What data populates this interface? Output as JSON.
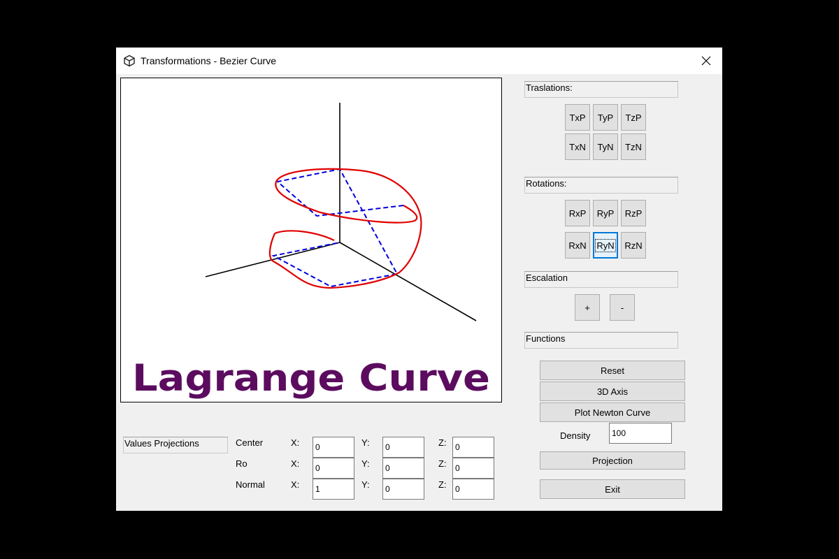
{
  "window": {
    "title": "Transformations - Bezier Curve"
  },
  "canvas": {
    "banner": "Lagrange Curve"
  },
  "translations": {
    "label": "Traslations:",
    "buttons": [
      "TxP",
      "TyP",
      "TzP",
      "TxN",
      "TyN",
      "TzN"
    ]
  },
  "rotations": {
    "label": "Rotations:",
    "buttons": [
      "RxP",
      "RyP",
      "RzP",
      "RxN",
      "RyN",
      "RzN"
    ],
    "focused": "RyN"
  },
  "escalation": {
    "label": "Escalation",
    "plus": "+",
    "minus": "-"
  },
  "functions": {
    "label": "Functions",
    "reset": "Reset",
    "axis": "3D Axis",
    "plot": "Plot Newton Curve",
    "projection": "Projection",
    "exit": "Exit"
  },
  "density": {
    "label": "Density",
    "value": "100"
  },
  "projections": {
    "label": "Values Projections",
    "axis_labels": {
      "x": "X:",
      "y": "Y:",
      "z": "Z:"
    },
    "center": {
      "label": "Center",
      "x": "0",
      "y": "0",
      "z": "0"
    },
    "ro": {
      "label": "Ro",
      "x": "0",
      "y": "0",
      "z": "0"
    },
    "normal": {
      "label": "Normal",
      "x": "1",
      "y": "0",
      "z": "0"
    }
  },
  "colors": {
    "curve": "#e00000",
    "control_polygon": "#0000dd",
    "axes": "#000000",
    "banner": "#5c0c5f",
    "focus": "#0078d7"
  },
  "icons": {
    "app": "cube-icon",
    "close": "close-icon"
  }
}
